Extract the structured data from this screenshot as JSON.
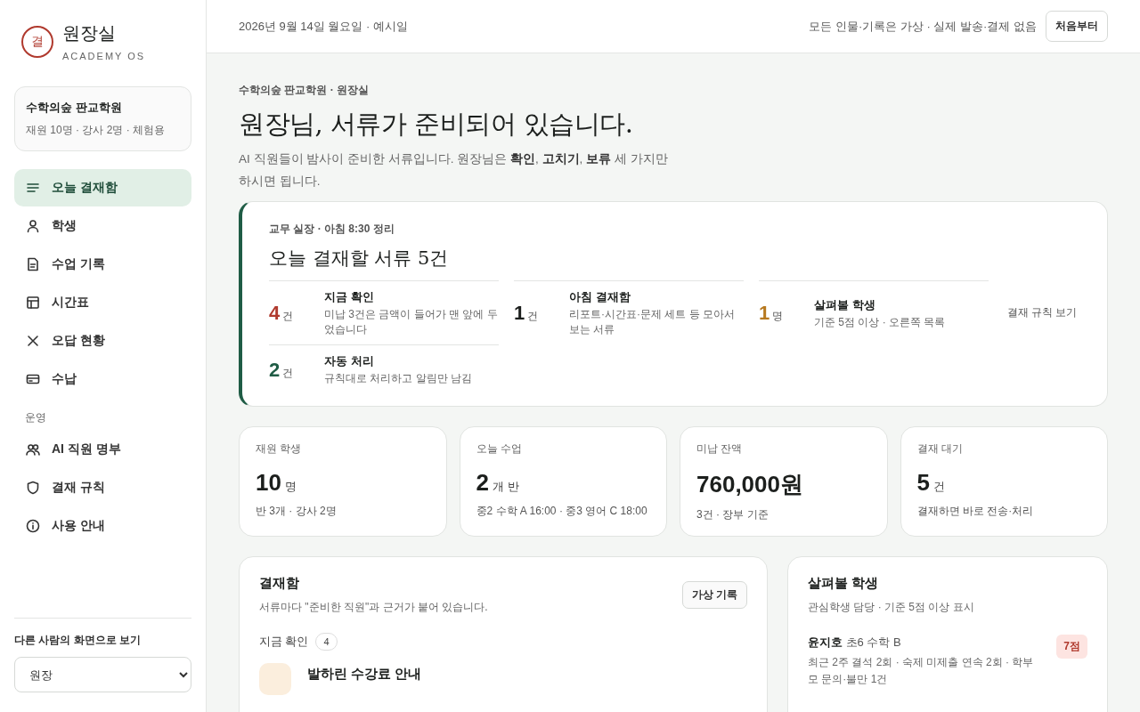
{
  "sidebar": {
    "logo_mark": "결",
    "title": "원장실",
    "subtitle": "ACADEMY OS",
    "org": {
      "name": "수학의숲 판교학원",
      "meta": "재원 10명 · 강사 2명 · 체험용"
    },
    "nav": [
      {
        "label": "오늘 결재함",
        "selected": true
      },
      {
        "label": "학생",
        "selected": false
      },
      {
        "label": "수업 기록",
        "selected": false
      },
      {
        "label": "시간표",
        "selected": false
      },
      {
        "label": "오답 현황",
        "selected": false
      },
      {
        "label": "수납",
        "selected": false
      }
    ],
    "section_label": "운영",
    "nav2": [
      {
        "label": "AI 직원 명부",
        "selected": false
      },
      {
        "label": "결재 규칙",
        "selected": false
      },
      {
        "label": "사용 안내",
        "selected": false
      }
    ],
    "viewer": {
      "label": "다른 사람의 화면으로 보기",
      "value": "원장"
    }
  },
  "topbar": {
    "date": "2026년 9월 14일 월요일 · 예시일",
    "notice": "모든 인물·기록은 가상 · 실제 발송·결제 없음",
    "button": "처음부터"
  },
  "hero": {
    "breadcrumb": "수학의숲 판교학원 · 원장실",
    "title": "원장님, 서류가 준비되어 있습니다.",
    "intro": "AI 직원들이 밤사이 준비한 서류입니다. 원장님은 **확인**, **고치기**, **보류** 세 가지만 하시면 됩니다."
  },
  "summary": {
    "byline": "교무 실장 · 아침 8:30 정리",
    "title": "오늘 결재할 서류 5건",
    "items": [
      {
        "count": "4",
        "unit": "건",
        "color": "#b03a2e",
        "title": "지금 확인",
        "desc": "미납 3건은 금액이 들어가 맨 앞에 두었습니다"
      },
      {
        "count": "1",
        "unit": "건",
        "color": "#1c1f1d",
        "title": "아침 결재함",
        "desc": "리포트·시간표·문제 세트 등 모아서 보는 서류"
      },
      {
        "count": "1",
        "unit": "명",
        "color": "#b7791f",
        "title": "살펴볼 학생",
        "desc": "기준 5점 이상 · 오른쪽 목록"
      },
      {
        "count": "2",
        "unit": "건",
        "color": "#1f5c45",
        "title": "자동 처리",
        "desc": "규칙대로 처리하고 알림만 남김"
      }
    ],
    "link": "결재 규칙 보기"
  },
  "stats": [
    {
      "label": "재원 학생",
      "value": "10",
      "unit": "명",
      "note": "반 3개 · 강사 2명"
    },
    {
      "label": "오늘 수업",
      "value": "2",
      "unit": "개 반",
      "note": "중2 수학 A 16:00 · 중3 영어 C 18:00"
    },
    {
      "label": "미납 잔액",
      "value": "760,000원",
      "note": "3건 · 장부 기준"
    },
    {
      "label": "결재 대기",
      "value": "5",
      "unit": "건",
      "note": "결재하면 바로 전송·처리"
    }
  ],
  "inbox": {
    "title": "결재함",
    "subtitle": "서류마다 \"준비한 직원\"과 근거가 붙어 있습니다.",
    "button": "가상 기록",
    "group": {
      "label": "지금 확인",
      "count": "4"
    },
    "items": [
      {
        "title": "발하린 수강료 안내"
      }
    ]
  },
  "watch": {
    "title": "살펴볼 학생",
    "subtitle": "관심학생 담당 · 기준 5점 이상 표시",
    "students": [
      {
        "name": "윤지호",
        "class": "초6 수학 B",
        "desc": "최근 2주 결석 2회 · 숙제 미제출 연속 2회 · 학부모 문의·불만 1건",
        "score": "7점"
      }
    ]
  }
}
